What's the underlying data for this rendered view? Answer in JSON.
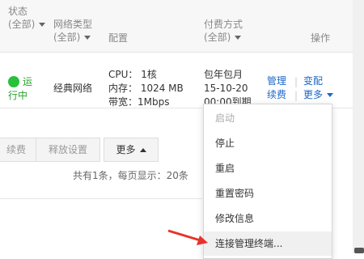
{
  "header": {
    "status": "状态",
    "status_filter": "(全部)",
    "network_type": "网络类型",
    "network_filter": "(全部)",
    "config": "配置",
    "billing": "付费方式",
    "billing_filter": "(全部)",
    "actions": "操作"
  },
  "row": {
    "status_line1": "运",
    "status_line2": "行中",
    "network": "经典网络",
    "cpu": "CPU： 1核",
    "memory": "内存： 1024 MB",
    "bandwidth": "带宽：1Mbps",
    "billing_line1": "包年包月",
    "billing_line2": "15-10-20",
    "billing_line3": "00:00到期",
    "manage": "管理",
    "renew": "续费",
    "change": "变配",
    "more": "更多"
  },
  "toolbar": {
    "renew": "续费",
    "release_settings": "释放设置",
    "more": "更多"
  },
  "pager": {
    "text": "共有1条，每页显示：20条"
  },
  "menu": {
    "items": [
      "启动",
      "停止",
      "重启",
      "重置密码",
      "修改信息",
      "连接管理终端..."
    ]
  },
  "colors": {
    "accent": "#1c68c6",
    "running": "#27c13c",
    "arrow": "#e8322b"
  }
}
